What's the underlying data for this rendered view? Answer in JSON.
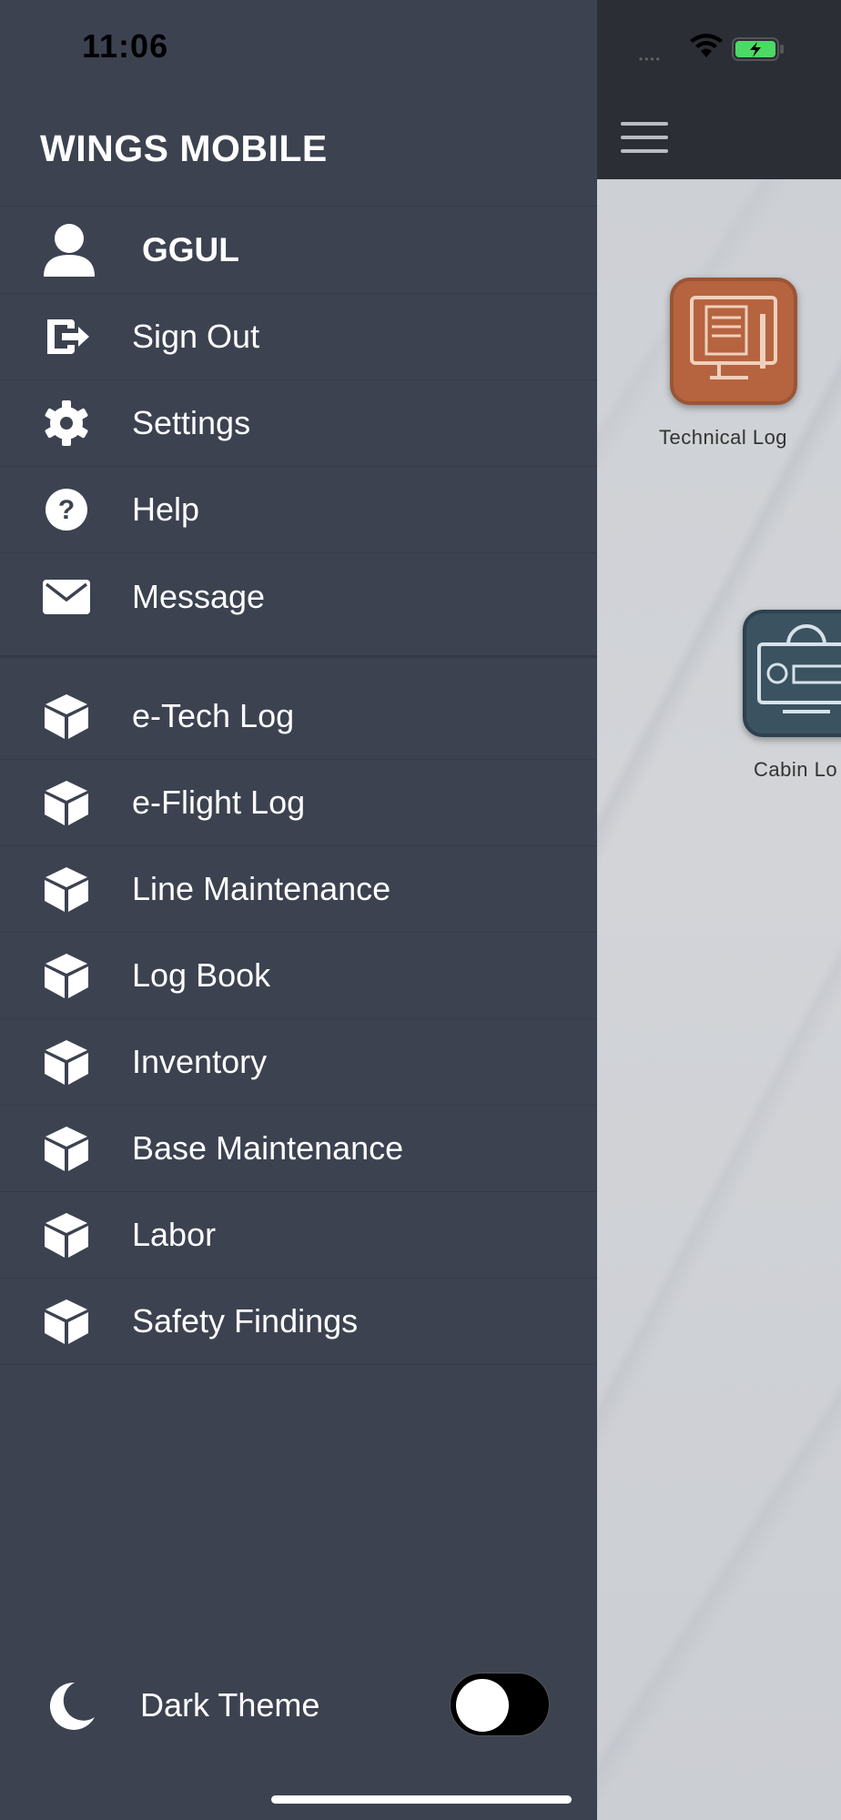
{
  "status_bar": {
    "time": "11:06"
  },
  "drawer": {
    "brand": "WINGS MOBILE",
    "user": {
      "name": "GGUL",
      "icon": "user-icon"
    },
    "account_items": [
      {
        "label": "Sign Out",
        "icon": "sign-out-icon"
      },
      {
        "label": "Settings",
        "icon": "gear-icon"
      },
      {
        "label": "Help",
        "icon": "help-icon"
      },
      {
        "label": "Message",
        "icon": "envelope-icon"
      }
    ],
    "module_items": [
      {
        "label": "e-Tech Log",
        "icon": "cube-icon"
      },
      {
        "label": "e-Flight Log",
        "icon": "cube-icon"
      },
      {
        "label": "Line Maintenance",
        "icon": "cube-icon"
      },
      {
        "label": "Log Book",
        "icon": "cube-icon"
      },
      {
        "label": "Inventory",
        "icon": "cube-icon"
      },
      {
        "label": "Base Maintenance",
        "icon": "cube-icon"
      },
      {
        "label": "Labor",
        "icon": "cube-icon"
      },
      {
        "label": "Safety Findings",
        "icon": "cube-icon"
      }
    ],
    "dark_theme": {
      "label": "Dark Theme",
      "icon": "moon-icon",
      "enabled": false
    }
  },
  "app": {
    "tiles": [
      {
        "label": "Technical Log",
        "color": "#b5643f"
      },
      {
        "label": "Cabin Lo",
        "color": "#3b5260"
      }
    ]
  },
  "colors": {
    "drawer_bg": "#3c4250",
    "text": "#ffffff"
  }
}
